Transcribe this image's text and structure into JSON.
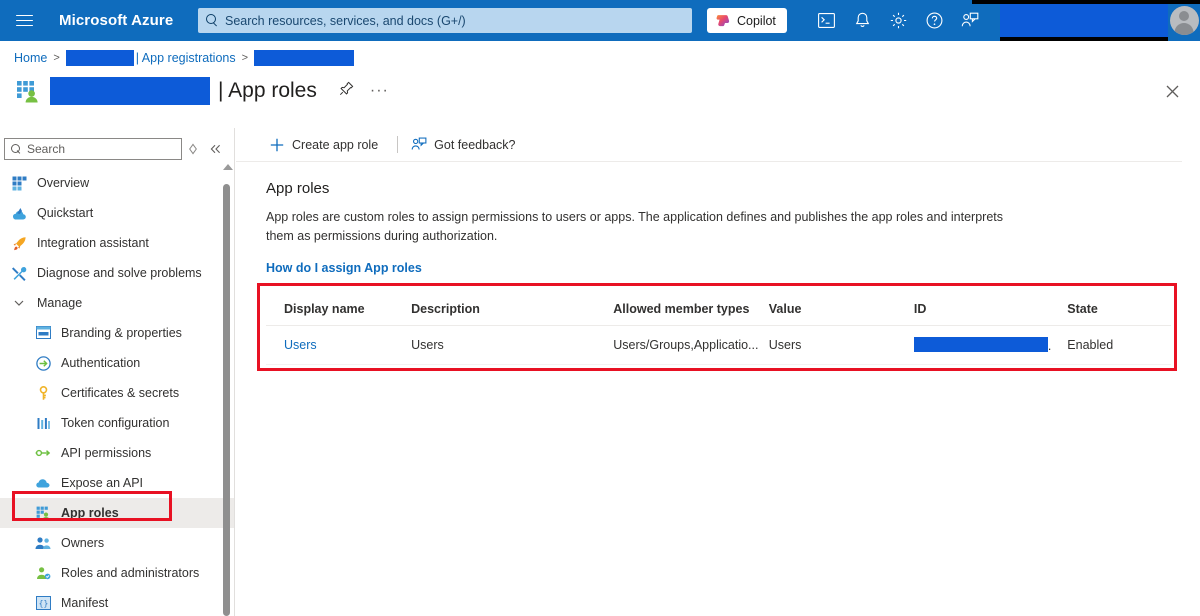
{
  "topbar": {
    "menu_icon": "hamburger-icon",
    "brand": "Microsoft Azure",
    "search_placeholder": "Search resources, services, and docs (G+/)",
    "search_value": "",
    "copilot_label": "Copilot",
    "icons": [
      {
        "name": "cloud-shell-icon",
        "label": "Cloud Shell"
      },
      {
        "name": "notifications-bell-icon",
        "label": "Notifications"
      },
      {
        "name": "settings-gear-icon",
        "label": "Settings"
      },
      {
        "name": "help-question-icon",
        "label": "Help"
      },
      {
        "name": "feedback-person-icon",
        "label": "Feedback"
      }
    ],
    "account_redacted": true,
    "avatar_name": "user-avatar"
  },
  "breadcrumb": {
    "home": "Home",
    "separator": ">",
    "redacted_1": "",
    "app_registrations": "| App registrations",
    "redacted_2": ""
  },
  "page_header": {
    "app_name_redacted": "",
    "title": "| App roles",
    "pin_icon": "pin-icon",
    "more_icon": "ellipsis-icon",
    "close_icon": "close-icon"
  },
  "leftnav": {
    "search_placeholder": "Search",
    "search_value": "",
    "sort_icon": "sort-diamond-icon",
    "collapse_icon": "double-chevron-left-icon",
    "items": [
      {
        "label": "Overview",
        "icon": "overview-grid-icon",
        "indent": false,
        "selected": false
      },
      {
        "label": "Quickstart",
        "icon": "quickstart-rocket-cloud-icon",
        "indent": false,
        "selected": false
      },
      {
        "label": "Integration assistant",
        "icon": "rocket-icon",
        "indent": false,
        "selected": false
      },
      {
        "label": "Diagnose and solve problems",
        "icon": "wrench-screwdriver-icon",
        "indent": false,
        "selected": false
      }
    ],
    "group": {
      "label": "Manage",
      "icon": "chevron-down-icon",
      "expanded": true
    },
    "group_items": [
      {
        "label": "Branding & properties",
        "icon": "branding-browser-icon",
        "indent": true,
        "selected": false
      },
      {
        "label": "Authentication",
        "icon": "authentication-arrow-icon",
        "indent": true,
        "selected": false
      },
      {
        "label": "Certificates & secrets",
        "icon": "key-icon",
        "indent": true,
        "selected": false
      },
      {
        "label": "Token configuration",
        "icon": "token-bars-icon",
        "indent": true,
        "selected": false
      },
      {
        "label": "API permissions",
        "icon": "api-permissions-icon",
        "indent": true,
        "selected": false
      },
      {
        "label": "Expose an API",
        "icon": "cloud-icon",
        "indent": true,
        "selected": false
      },
      {
        "label": "App roles",
        "icon": "app-roles-icon",
        "indent": true,
        "selected": true
      },
      {
        "label": "Owners",
        "icon": "owners-people-icon",
        "indent": true,
        "selected": false
      },
      {
        "label": "Roles and administrators",
        "icon": "roles-person-icon",
        "indent": true,
        "selected": false
      },
      {
        "label": "Manifest",
        "icon": "manifest-braces-icon",
        "indent": true,
        "selected": false
      }
    ]
  },
  "toolbar": {
    "create_label": "Create app role",
    "create_icon": "plus-icon",
    "feedback_label": "Got feedback?",
    "feedback_icon": "feedback-person-icon"
  },
  "content": {
    "heading": "App roles",
    "description": "App roles are custom roles to assign permissions to users or apps. The application defines and publishes the app roles and interprets them as permissions during authorization.",
    "assign_link": "How do I assign App roles"
  },
  "table": {
    "columns": [
      "Display name",
      "Description",
      "Allowed member types",
      "Value",
      "ID",
      "State"
    ],
    "rows": [
      {
        "display_name": "Users",
        "description": "Users",
        "allowed_member_types": "Users/Groups,Applicatio...",
        "value": "Users",
        "id_redacted": true,
        "id_suffix": ".",
        "state": "Enabled"
      }
    ]
  },
  "annotations": {
    "color": "#e81123",
    "boxes": [
      {
        "name": "app-roles-nav-highlight"
      },
      {
        "name": "app-roles-table-highlight"
      }
    ]
  },
  "colors": {
    "header_blue": "#0f6cbd",
    "link_blue": "#0f6cbd",
    "redaction_blue": "#0d5bd8",
    "annotation_red": "#e81123",
    "selected_bg": "#edebe9"
  }
}
